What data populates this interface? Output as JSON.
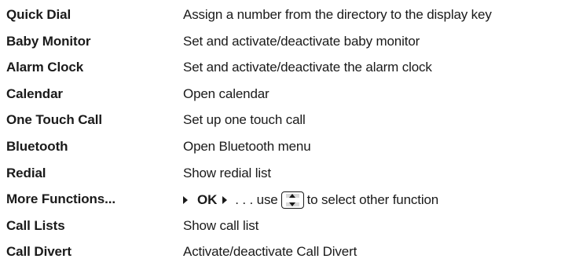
{
  "functions": [
    {
      "name": "Quick Dial",
      "description": "Assign a number from the directory to the display key"
    },
    {
      "name": "Baby Monitor",
      "description": "Set and activate/deactivate baby monitor"
    },
    {
      "name": "Alarm Clock",
      "description": "Set and activate/deactivate the alarm clock"
    },
    {
      "name": "Calendar",
      "description": "Open calendar"
    },
    {
      "name": "One Touch Call",
      "description": "Set up one touch call"
    },
    {
      "name": "Bluetooth",
      "description": "Open Bluetooth menu"
    },
    {
      "name": "Redial",
      "description": "Show redial list"
    },
    {
      "name": "More Functions...",
      "instruction": {
        "ok_label": "OK",
        "prefix": ". . . use",
        "icon": "up-down-navigation-key-icon",
        "suffix": "to select other function"
      }
    },
    {
      "name": "Call Lists",
      "description": "Show call list"
    },
    {
      "name": "Call Divert",
      "description": "Activate/deactivate Call Divert"
    }
  ]
}
